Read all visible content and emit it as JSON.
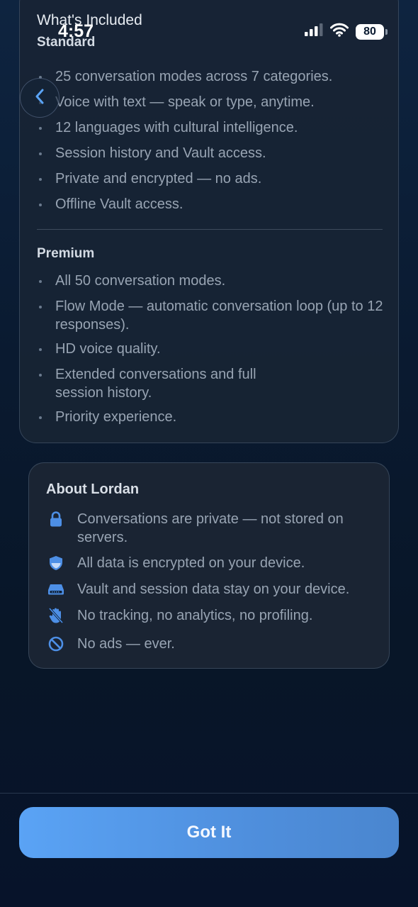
{
  "status_bar": {
    "time": "4:57",
    "battery": "80"
  },
  "whats_included": {
    "title": "What's Included",
    "standard": {
      "title": "Standard",
      "items": [
        "25 conversation modes across 7 categories.",
        "Voice with text — speak or type, anytime.",
        "12 languages with cultural intelligence.",
        "Session history and Vault access.",
        "Private and encrypted — no ads.",
        "Offline Vault access."
      ]
    },
    "premium": {
      "title": "Premium",
      "items": [
        "All 50 conversation modes.",
        "Flow Mode — automatic conversation loop (up to 12 responses).",
        "HD voice quality.",
        "Extended conversations and full session history.",
        "Priority experience."
      ]
    }
  },
  "about": {
    "title": "About Lordan",
    "items": [
      {
        "icon": "lock-icon",
        "text": "Conversations are private — not stored on servers."
      },
      {
        "icon": "shield-icon",
        "text": "All data is encrypted on your device."
      },
      {
        "icon": "drive-icon",
        "text": "Vault and session data stay on your device."
      },
      {
        "icon": "no-tracking-hand-icon",
        "text": "No tracking, no analytics, no profiling."
      },
      {
        "icon": "prohibited-icon",
        "text": "No ads — ever."
      }
    ]
  },
  "footer": {
    "button_label": "Got It"
  },
  "colors": {
    "accent": "#5aa3f5",
    "icon_blue": "#4d8fe6"
  }
}
